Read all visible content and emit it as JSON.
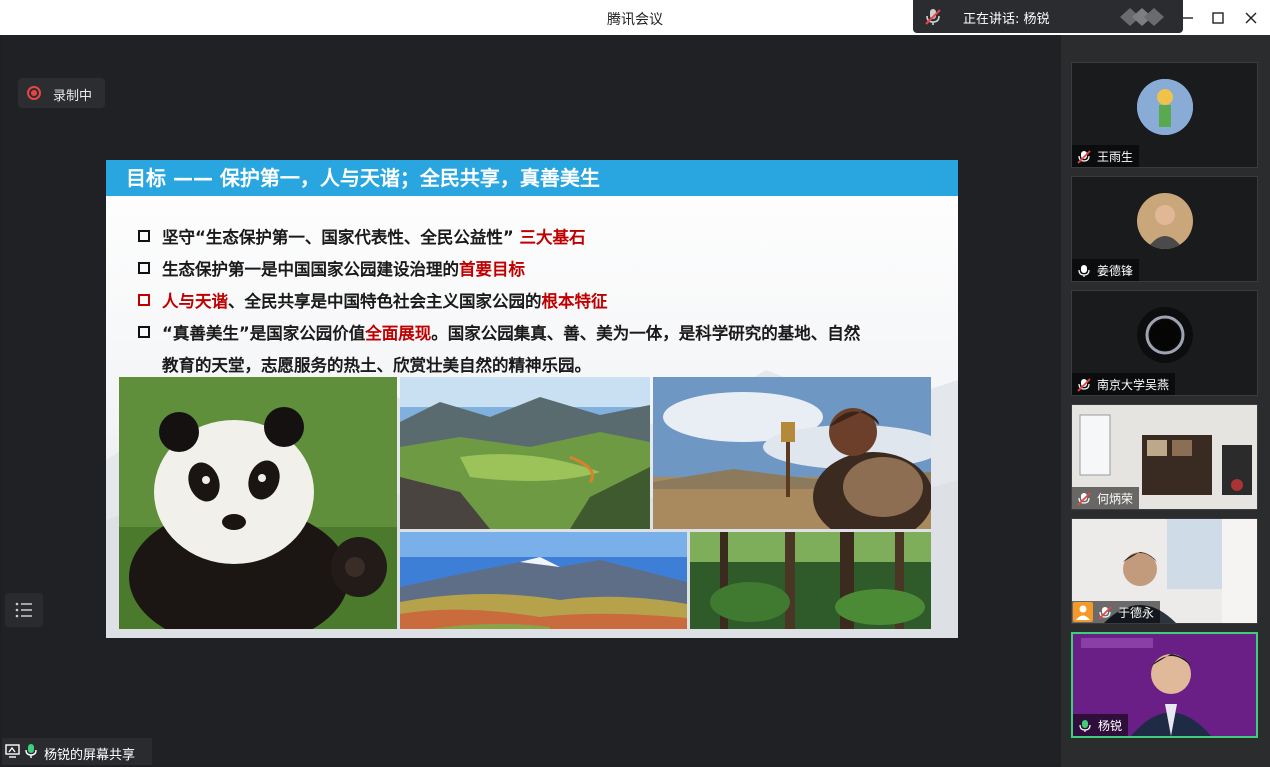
{
  "window": {
    "title": "腾讯会议",
    "speaking_label": "正在讲话: 杨锐",
    "controls": [
      "minimize",
      "maximize",
      "close"
    ]
  },
  "recording": {
    "label": "录制中"
  },
  "share_bar": {
    "label": "杨锐的屏幕共享"
  },
  "slide": {
    "heading": "目标 —— 保护第一，人与天谐；全民共享，真善美生",
    "bullets": [
      {
        "plain": "坚守“生态保护第一、国家代表性、全民公益性”",
        "highlight": "三大基石"
      },
      {
        "plain": "生态保护第一是中国国家公园建设治理的",
        "highlight": "首要目标"
      },
      {
        "highlight_start": "人与天谐",
        "plain": "、全民共享是中国特色社会主义国家公园的",
        "highlight": "根本特征"
      },
      {
        "plain_pre": "“真善美生”是国家公园价值",
        "highlight": "全面展现",
        "plain_post": "。国家公园集真、善、美为一体，是科学研究的基地、自然",
        "line2": "教育的天堂，志愿服务的热土、欣赏壮美自然的精神乐园。"
      }
    ],
    "photos": [
      "giant-panda",
      "mountain-valley",
      "tibetan-elder-with-prayer-wheel",
      "colorful-hills",
      "forest"
    ]
  },
  "participants": [
    {
      "name": "王雨生",
      "mic": "muted"
    },
    {
      "name": "姜德锋",
      "mic": "on"
    },
    {
      "name": "南京大学吴燕",
      "mic": "muted"
    },
    {
      "name": "何炳荣",
      "mic": "muted"
    },
    {
      "name": "于德永",
      "mic": "muted"
    },
    {
      "name": "杨锐",
      "mic": "on",
      "speaking": true
    }
  ],
  "colors": {
    "accent": "#29a6e0",
    "highlight": "#c00000",
    "active_border": "#3fce7a"
  }
}
